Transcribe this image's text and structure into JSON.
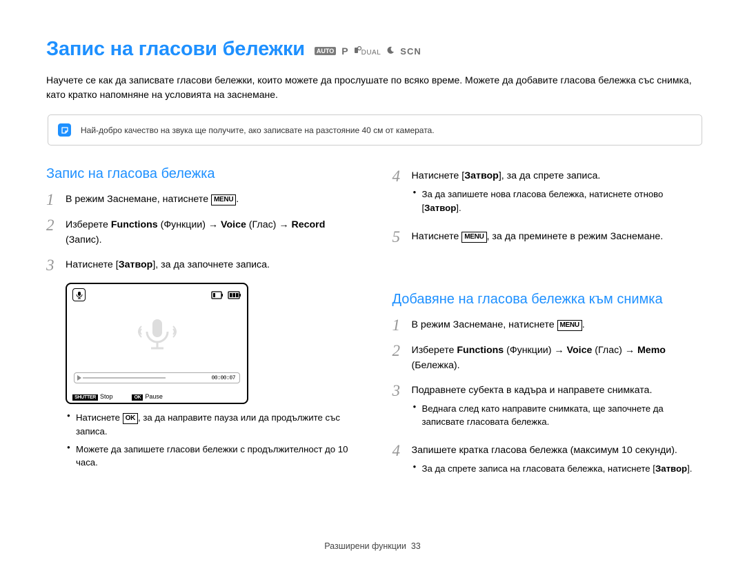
{
  "title": "Запис на гласови бележки",
  "mode_badges": {
    "auto": "AUTO",
    "p": "P",
    "dual": "DUAL",
    "scn": "SCN"
  },
  "intro": "Научете се как да записвате гласови бележки, които можете да прослушате по всяко време. Можете да добавите гласова бележка със снимка, като кратко напомняне на условията на заснемане.",
  "note": "Най-добро качество на звука ще получите, ако записвате на разстояние 40 см от камерата.",
  "left": {
    "heading": "Запис на гласова бележка",
    "step1": {
      "pre": "В режим Заснемане, натиснете ",
      "menu": "MENU",
      "post": "."
    },
    "step2": {
      "pre": "Изберете ",
      "functions": "Functions",
      "functions_tr": " (Функции) → ",
      "voice": "Voice",
      "voice_tr": " (Глас) → ",
      "record": "Record",
      "record_tr": " (Запис)."
    },
    "step3": {
      "pre": "Натиснете [",
      "btn": "Затвор",
      "post": "], за да започнете записа."
    },
    "lcd": {
      "time": "00:00:07",
      "shutter_label": "SHUTTER",
      "shutter_action": "Stop",
      "ok_label": "OK",
      "ok_action": "Pause"
    },
    "bullets": [
      {
        "pre": "Натиснете ",
        "box": "OK",
        "post": ", за да направите пауза или да продължите със записа."
      },
      {
        "text": "Можете да запишете гласови бележки с продължителност до 10 часа."
      }
    ]
  },
  "right": {
    "step4": {
      "pre": "Натиснете [",
      "btn": "Затвор",
      "post": "], за да спрете записа."
    },
    "step4_bullet": {
      "pre": "За да запишете нова гласова бележка, натиснете отново [",
      "btn": "Затвор",
      "post": "]."
    },
    "step5": {
      "pre": "Натиснете ",
      "menu": "MENU",
      "post": ", за да преминете в режим Заснемане."
    },
    "heading2": "Добавяне на гласова бележка към снимка",
    "b_step1": {
      "pre": "В режим Заснемане, натиснете ",
      "menu": "MENU",
      "post": "."
    },
    "b_step2": {
      "pre": "Изберете ",
      "functions": "Functions",
      "functions_tr": " (Функции) → ",
      "voice": "Voice",
      "voice_tr": " (Глас) → ",
      "memo": "Memo",
      "memo_tr": " (Бележка)."
    },
    "b_step3": "Подравнете субекта в кадъра и направете снимката.",
    "b_step3_bullet": "Веднага след като направите снимката, ще започнете да записвате гласовата бележка.",
    "b_step4": "Запишете кратка гласова бележка (максимум 10 секунди).",
    "b_step4_bullet": {
      "pre": "За да спрете записа на гласовата бележка, натиснете [",
      "btn": "Затвор",
      "post": "]."
    }
  },
  "footer": {
    "section": "Разширени функции",
    "page": "33"
  }
}
